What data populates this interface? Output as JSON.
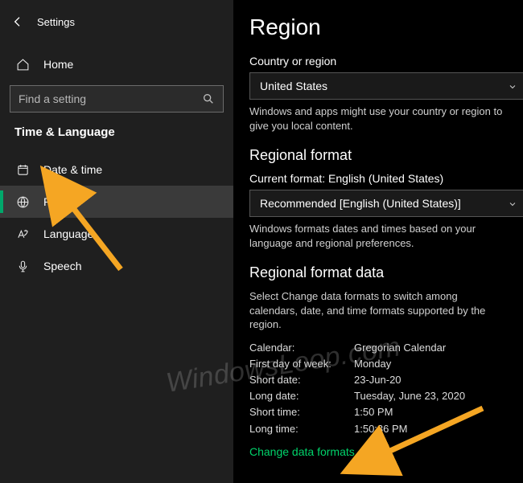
{
  "sidebar": {
    "settings_title": "Settings",
    "home_label": "Home",
    "search_placeholder": "Find a setting",
    "category": "Time & Language",
    "items": [
      {
        "label": "Date & time"
      },
      {
        "label": "Region"
      },
      {
        "label": "Language"
      },
      {
        "label": "Speech"
      }
    ]
  },
  "main": {
    "title": "Region",
    "country_label": "Country or region",
    "country_value": "United States",
    "country_desc": "Windows and apps might use your country or region to give you local content.",
    "regional_format_heading": "Regional format",
    "current_format_label": "Current format: English (United States)",
    "regional_format_value": "Recommended [English (United States)]",
    "regional_format_desc": "Windows formats dates and times based on your language and regional preferences.",
    "format_data_heading": "Regional format data",
    "format_data_desc": "Select Change data formats to switch among calendars, date, and time formats supported by the region.",
    "rows": [
      {
        "k": "Calendar:",
        "v": "Gregorian Calendar"
      },
      {
        "k": "First day of week:",
        "v": "Monday"
      },
      {
        "k": "Short date:",
        "v": "23-Jun-20"
      },
      {
        "k": "Long date:",
        "v": "Tuesday, June 23, 2020"
      },
      {
        "k": "Short time:",
        "v": "1:50 PM"
      },
      {
        "k": "Long time:",
        "v": "1:50:36 PM"
      }
    ],
    "change_link": "Change data formats"
  },
  "watermark": "WindowsLoop.com",
  "accent_color": "#00d26a"
}
